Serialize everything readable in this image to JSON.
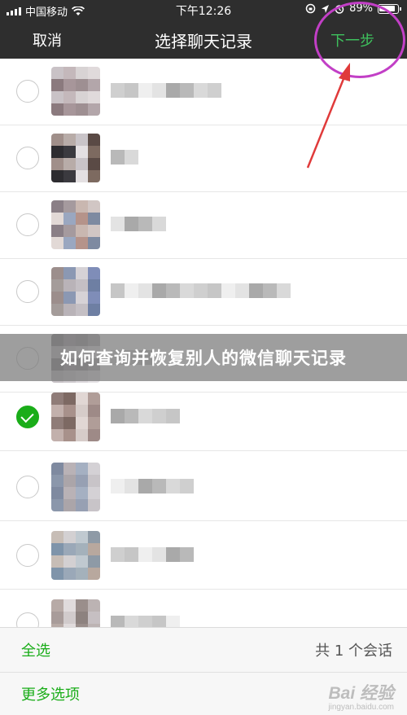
{
  "status_bar": {
    "carrier": "中国移动",
    "time": "下午12:26",
    "battery": "89%"
  },
  "nav": {
    "cancel_label": "取消",
    "title": "选择聊天记录",
    "next_label": "下一步"
  },
  "banner": {
    "text": "如何查询并恢复别人的微信聊天记录"
  },
  "contacts": [
    {
      "selected": false
    },
    {
      "selected": false
    },
    {
      "selected": false
    },
    {
      "selected": false
    },
    {
      "selected": false
    },
    {
      "selected": true
    },
    {
      "selected": false
    },
    {
      "selected": false
    },
    {
      "selected": false
    }
  ],
  "bottom_bar": {
    "select_all_label": "全选",
    "count_text": "共 1 个会话",
    "more_options_label": "更多选项"
  },
  "watermark": {
    "logo": "Bai 经验",
    "url": "jingyan.baidu.com"
  },
  "colors": {
    "nav_background": "#2e2e2e",
    "accent_green": "#1aad19",
    "next_green": "#3ec15d",
    "annotation_magenta": "#c23fc6",
    "annotation_red": "#e03a3a"
  }
}
